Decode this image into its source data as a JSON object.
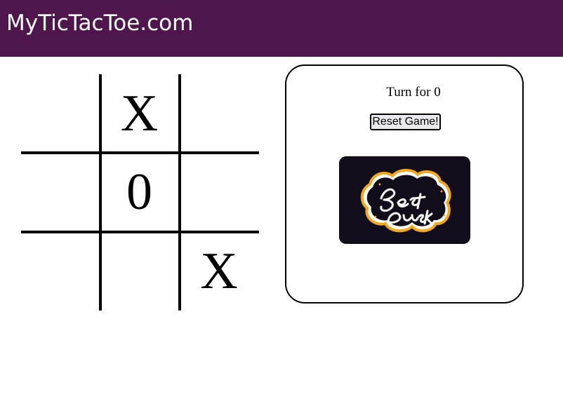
{
  "header": {
    "site_title": "MyTicTacToe.com",
    "background_color": "#4e164d"
  },
  "board": {
    "cells": [
      "",
      "X",
      "",
      "",
      "0",
      "",
      "",
      "",
      "X"
    ]
  },
  "panel": {
    "turn_text": "Turn for 0",
    "reset_label": "Reset Game!",
    "image": {
      "icon": "best-of-luck-lettering",
      "lettering": "Best of Luck",
      "background_color": "#110d1b",
      "accent_color": "#f3a81c"
    }
  }
}
